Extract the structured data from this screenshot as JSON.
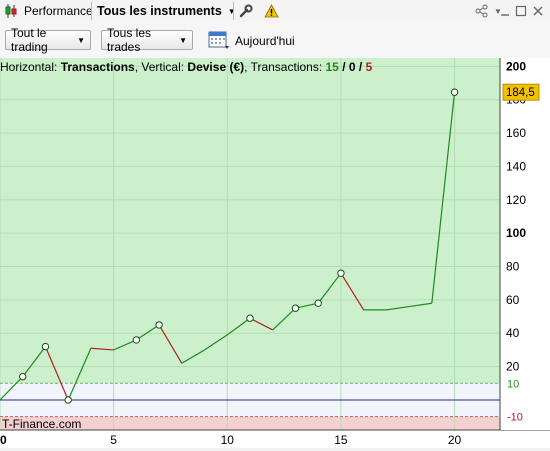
{
  "toolbar": {
    "performance_label": "Performance",
    "instruments_label": "Tous les instruments"
  },
  "filters": {
    "trading_label": "Tout le trading",
    "trades_label": "Tous les trades",
    "date_label": "Aujourd'hui"
  },
  "info": {
    "horizontal_prefix": "Horizontal: ",
    "horizontal_value": "Transactions",
    "vertical_prefix": ", Vertical: ",
    "vertical_value": "Devise (€)",
    "transactions_prefix": ", Transactions: ",
    "count_win": "15",
    "count_sep1": " / ",
    "count_even": "0",
    "count_sep2": " / ",
    "count_loss": "5"
  },
  "watermark": "T-Finance.com",
  "colors": {
    "profit_zone": "#ccf0cc",
    "loss_zone": "#f5d0d0",
    "up_line": "#1e8a1e",
    "down_line": "#b02020",
    "last_value_badge": "#f2c200"
  },
  "chart_data": {
    "type": "line",
    "x": [
      0,
      1,
      2,
      3,
      4,
      5,
      6,
      7,
      8,
      9,
      10,
      11,
      12,
      13,
      14,
      15,
      16,
      17,
      18,
      19,
      20
    ],
    "y": [
      0,
      14,
      32,
      0,
      31,
      30,
      36,
      45,
      22,
      30,
      39,
      49,
      42,
      55,
      58,
      76,
      54,
      54,
      56,
      58,
      184.5
    ],
    "markers_at": [
      1,
      2,
      3,
      6,
      7,
      11,
      13,
      14,
      15,
      20
    ],
    "xlim": [
      0,
      22
    ],
    "ylim": [
      -18,
      205
    ],
    "x_ticks": [
      0,
      5,
      10,
      15,
      20
    ],
    "y_ticks": [
      200,
      180,
      160,
      140,
      120,
      100,
      80,
      60,
      40,
      20
    ],
    "y_ticks_bold": [
      200,
      100
    ],
    "last_value_label": "184,5",
    "band_upper": 10,
    "band_upper_label": "10",
    "band_lower": -10,
    "band_lower_label": "-10"
  }
}
